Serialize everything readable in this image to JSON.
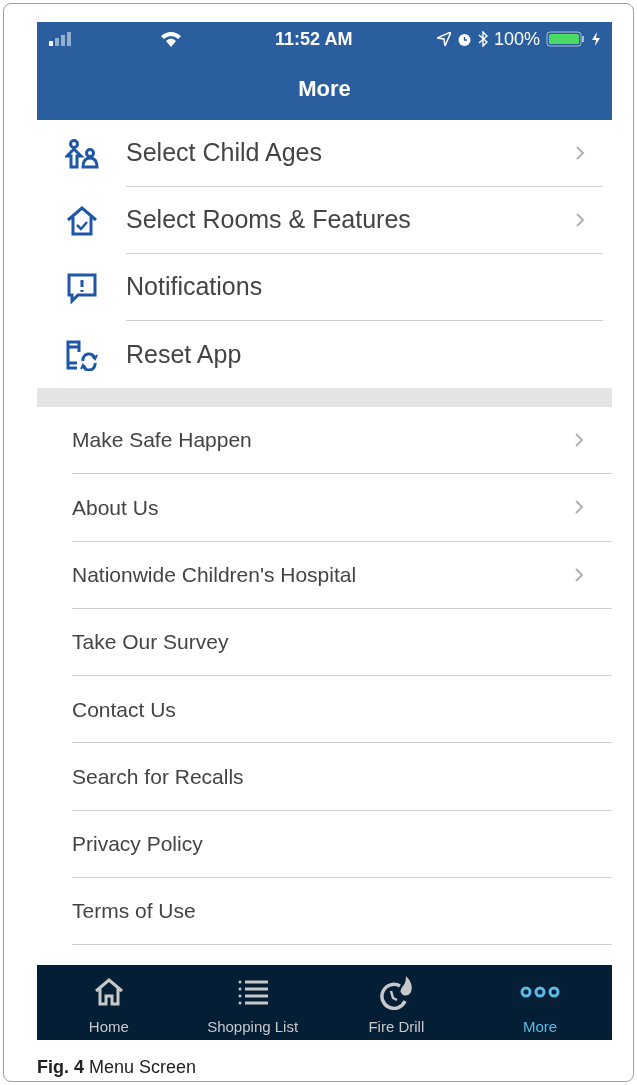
{
  "status_bar": {
    "time": "11:52 AM",
    "battery": "100%"
  },
  "nav_bar": {
    "title": "More"
  },
  "primary_items": [
    {
      "label": "Select Child Ages",
      "kind": "children",
      "chevron": true
    },
    {
      "label": "Select Rooms & Features",
      "kind": "house",
      "chevron": true
    },
    {
      "label": "Notifications",
      "kind": "alert",
      "chevron": false
    },
    {
      "label": "Reset App",
      "kind": "reset",
      "chevron": false
    }
  ],
  "secondary_items": [
    {
      "label": "Make Safe Happen",
      "chevron": true
    },
    {
      "label": "About Us",
      "chevron": true
    },
    {
      "label": "Nationwide Children's Hospital",
      "chevron": true
    },
    {
      "label": "Take Our Survey",
      "chevron": false
    },
    {
      "label": "Contact Us",
      "chevron": false
    },
    {
      "label": "Search for Recalls",
      "chevron": false
    },
    {
      "label": "Privacy Policy",
      "chevron": false
    },
    {
      "label": "Terms of Use",
      "chevron": false
    }
  ],
  "tabs": [
    {
      "label": "Home",
      "kind": "home",
      "selected": false
    },
    {
      "label": "Shopping List",
      "kind": "list",
      "selected": false
    },
    {
      "label": "Fire Drill",
      "kind": "fire",
      "selected": false
    },
    {
      "label": "More",
      "kind": "more",
      "selected": true
    }
  ],
  "caption": "**Fig. 4** Menu Screen"
}
